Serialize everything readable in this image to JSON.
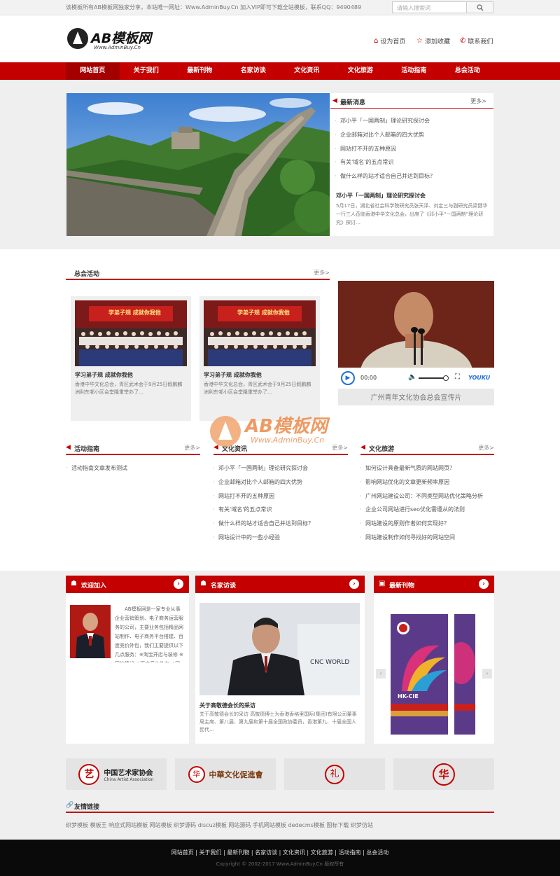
{
  "topbar": {
    "notice": "该模板所有AB模板网独家分享，本站唯一网址：Www.AdminBuy.Cn 加入VIP即可下载全站模板，联系QQ：9490489",
    "search_placeholder": "请输入搜索词"
  },
  "header": {
    "logo_name": "AB模板网",
    "logo_url": "Www.AdminBuy.Cn",
    "links": [
      "设为首页",
      "添加收藏",
      "联系我们"
    ]
  },
  "nav": [
    "网站首页",
    "关于我们",
    "最新刊物",
    "名家访谈",
    "文化资讯",
    "文化旅游",
    "活动指南",
    "总会活动"
  ],
  "news": {
    "title": "最新消息",
    "more": "更多>",
    "items": [
      "邓小平「一国两制」理论研究探讨会",
      "企业邮箱对比个人邮箱的四大优势",
      "网站打不开的五种原因",
      "有关'域名'的五点常识",
      "做什么样的站才适合自己并达到目标？"
    ],
    "feature_title": "邓小平「一国两制」理论研究探讨会",
    "feature_desc": "5月17日，湖北省社会科学院研究员张天泽、刘定三与副研究员梁健华一行三人莅临香港中华文化总会，出席了《邓小平“一国两制”理论研究》探讨…"
  },
  "zonghui": {
    "title": "总会活动",
    "more": "更多>",
    "cards": [
      {
        "title": "学习弟子规 成就你我他",
        "desc": "香港中华文化总会，青区武术会于9月25日假鹏麟洲利东邨小区会堂隆重举办了…",
        "banner": "学弟子规 成就你我他"
      },
      {
        "title": "学习弟子规 成就你我他",
        "desc": "香港中华文化总会，青区武术会于9月25日假鹏麟洲利东邨小区会堂隆重举办了…",
        "banner": "学弟子规 成就你我他"
      }
    ]
  },
  "video": {
    "time": "00:00",
    "brand": "YOUKU",
    "caption": "广州青年文化协会总会宣传片"
  },
  "watermark": {
    "name": "AB模板网",
    "url": "Www.AdminBuy.Cn"
  },
  "three_cols": [
    {
      "title": "活动指南",
      "more": "更多>",
      "items": [
        "活动指南文章发布测试"
      ]
    },
    {
      "title": "文化资讯",
      "more": "更多>",
      "items": [
        "邓小平「一国两制」理论研究探讨会",
        "企业邮箱对比个人邮箱的四大优势",
        "网站打不开的五种原因",
        "有关'域名'的五点常识",
        "做什么样的站才适合自己并达到目标？",
        "网站设计中的一些小经验"
      ]
    },
    {
      "title": "文化旅游",
      "more": "更多>",
      "items": [
        "如何设计具备最新气质的网站网页？",
        "影响网站优化的文章更新频率原因",
        "广州网站建设公司：不同类型网站优化策略分析",
        "企业公司网站进行seo优化需遵从的法则",
        "网站建设的原则作者如何实现好？",
        "网站建设制作如何寻找好的网站空间"
      ]
    }
  ],
  "welcome": {
    "title": "欢迎加入",
    "text": "AB模板网是一家专业从事企业营销策划、电子商务运营服务的公司，主要业务包括精品网站制作、电子商务平台搭建、百度竞价外包，我们主要提供以下几点服务：※淘宝开店与装修 ※网站建设 ※百度竞价外包 ※网络营销外包 ※。以真心换真情，站在客户角度，客户的满意就是我们的追求，切实站在客户…"
  },
  "interview": {
    "title": "名家访谈",
    "item_title": "关于高敬德会长的采访",
    "item_desc": "关于高敬德会长的采访 高敬德博士为香港香格里国际(集团)有限公司董事局主席、第八届、第九届和第十届全国政协委员，香港第九、十届全国人民代…",
    "backdrop": "CNC WORLD"
  },
  "periodical": {
    "title": "最新刊物",
    "cover_label": "HK-CIE"
  },
  "partners": [
    {
      "cn": "中国艺术家协会",
      "en": "China Artist Association"
    },
    {
      "cn": "中華文化促進會",
      "en": ""
    },
    {
      "cn": "",
      "en": ""
    },
    {
      "cn": "",
      "en": ""
    }
  ],
  "friend_links": {
    "title": "友情链接",
    "items": "织梦模板 模板王 响应式网站模板 网站模板 织梦源码 discuz模板 网站源码 手机网站模板 dedecms模板 图标下载 织梦仿站"
  },
  "footer": {
    "links": "网站首页 | 关于我们 | 最新刊物 | 名家访谈 | 文化资讯 | 文化旅游 | 活动指南 | 总会活动",
    "copyright": "Copyright © 2002-2017 Www.AdminBuy.Cn 版权所有"
  },
  "colors": {
    "brand_red": "#c40000",
    "gray_band": "#efefef",
    "footer_bg": "#0a0a0a"
  }
}
